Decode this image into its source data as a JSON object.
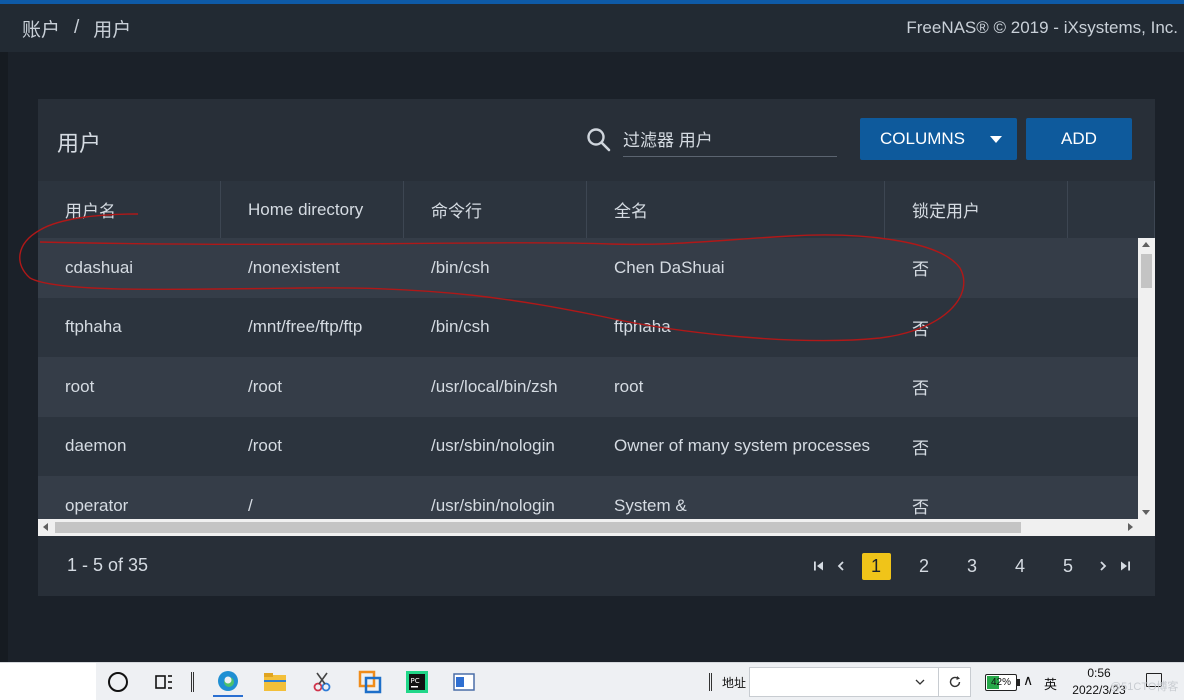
{
  "header": {
    "breadcrumb": [
      "账户",
      "/",
      "用户"
    ],
    "copyright": "FreeNAS® © 2019 - iXsystems, Inc."
  },
  "card": {
    "title": "用户",
    "search_placeholder": "过滤器 用户",
    "columns_label": "COLUMNS",
    "add_label": "ADD"
  },
  "table": {
    "headers": [
      "用户名",
      "Home directory",
      "命令行",
      "全名",
      "锁定用户"
    ],
    "rows": [
      {
        "username": "cdashuai",
        "home": "/nonexistent",
        "shell": "/bin/csh",
        "fullname": "Chen DaShuai",
        "locked": "否"
      },
      {
        "username": "ftphaha",
        "home": "/mnt/free/ftp/ftp",
        "shell": "/bin/csh",
        "fullname": "ftphaha",
        "locked": "否"
      },
      {
        "username": "root",
        "home": "/root",
        "shell": "/usr/local/bin/zsh",
        "fullname": "root",
        "locked": "否"
      },
      {
        "username": "daemon",
        "home": "/root",
        "shell": "/usr/sbin/nologin",
        "fullname": "Owner of many system processes",
        "locked": "否"
      },
      {
        "username": "operator",
        "home": "/",
        "shell": "/usr/sbin/nologin",
        "fullname": "System &",
        "locked": "否"
      }
    ]
  },
  "pagination": {
    "range": "1 - 5 of 35",
    "pages": [
      "1",
      "2",
      "3",
      "4",
      "5"
    ],
    "active": "1"
  },
  "taskbar": {
    "address_label": "地址",
    "battery": "42%",
    "battery_level": 0.42,
    "ime": "英",
    "time": "0:56",
    "date": "2022/3/23"
  },
  "watermark": "@51CTO博客",
  "colors": {
    "accent": "#0e5a9c",
    "page_active": "#f0c419",
    "annotation": "#b01818"
  }
}
